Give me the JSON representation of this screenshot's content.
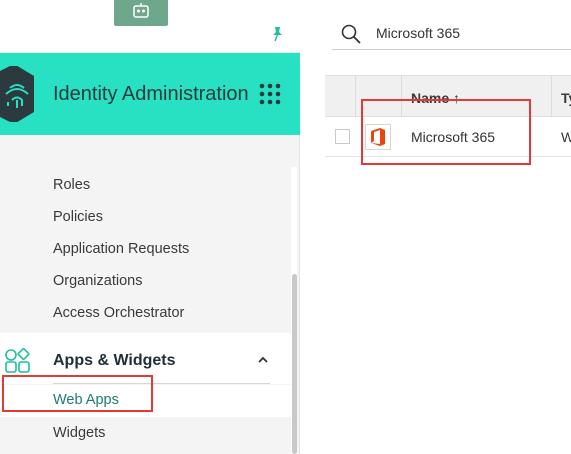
{
  "sidebar": {
    "app_title": "Identity Administration",
    "nav_items": [
      {
        "label": "Roles"
      },
      {
        "label": "Policies"
      },
      {
        "label": "Application Requests"
      },
      {
        "label": "Organizations"
      },
      {
        "label": "Access Orchestrator"
      }
    ],
    "section": {
      "title": "Apps & Widgets",
      "items": [
        {
          "label": "Web Apps",
          "active": true
        },
        {
          "label": "Widgets",
          "active": false
        }
      ]
    }
  },
  "main": {
    "search": {
      "value": "Microsoft 365"
    },
    "table": {
      "columns": [
        "Name ↑",
        "Ty"
      ],
      "rows": [
        {
          "name": "Microsoft 365",
          "type": "W"
        }
      ]
    }
  },
  "colors": {
    "header_accent": "#28e1c2",
    "active_link": "#1e7b6d",
    "annotation": "#e53935",
    "office_icon": "#e8470f"
  }
}
